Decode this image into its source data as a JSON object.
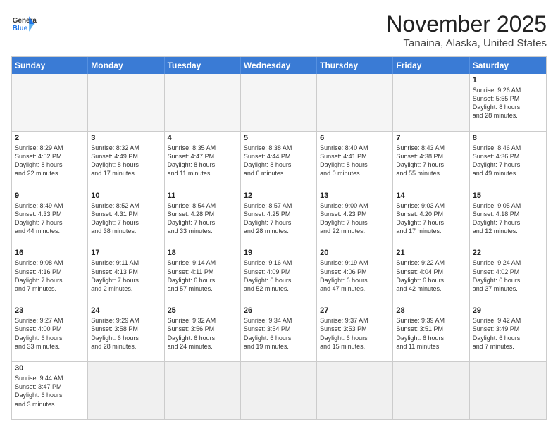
{
  "logo": {
    "text_general": "General",
    "text_blue": "Blue"
  },
  "title": "November 2025",
  "location": "Tanaina, Alaska, United States",
  "weekdays": [
    "Sunday",
    "Monday",
    "Tuesday",
    "Wednesday",
    "Thursday",
    "Friday",
    "Saturday"
  ],
  "weeks": [
    [
      {
        "day": "",
        "content": ""
      },
      {
        "day": "",
        "content": ""
      },
      {
        "day": "",
        "content": ""
      },
      {
        "day": "",
        "content": ""
      },
      {
        "day": "",
        "content": ""
      },
      {
        "day": "",
        "content": ""
      },
      {
        "day": "1",
        "content": "Sunrise: 9:26 AM\nSunset: 5:55 PM\nDaylight: 8 hours\nand 28 minutes."
      }
    ],
    [
      {
        "day": "2",
        "content": "Sunrise: 8:29 AM\nSunset: 4:52 PM\nDaylight: 8 hours\nand 22 minutes."
      },
      {
        "day": "3",
        "content": "Sunrise: 8:32 AM\nSunset: 4:49 PM\nDaylight: 8 hours\nand 17 minutes."
      },
      {
        "day": "4",
        "content": "Sunrise: 8:35 AM\nSunset: 4:47 PM\nDaylight: 8 hours\nand 11 minutes."
      },
      {
        "day": "5",
        "content": "Sunrise: 8:38 AM\nSunset: 4:44 PM\nDaylight: 8 hours\nand 6 minutes."
      },
      {
        "day": "6",
        "content": "Sunrise: 8:40 AM\nSunset: 4:41 PM\nDaylight: 8 hours\nand 0 minutes."
      },
      {
        "day": "7",
        "content": "Sunrise: 8:43 AM\nSunset: 4:38 PM\nDaylight: 7 hours\nand 55 minutes."
      },
      {
        "day": "8",
        "content": "Sunrise: 8:46 AM\nSunset: 4:36 PM\nDaylight: 7 hours\nand 49 minutes."
      }
    ],
    [
      {
        "day": "9",
        "content": "Sunrise: 8:49 AM\nSunset: 4:33 PM\nDaylight: 7 hours\nand 44 minutes."
      },
      {
        "day": "10",
        "content": "Sunrise: 8:52 AM\nSunset: 4:31 PM\nDaylight: 7 hours\nand 38 minutes."
      },
      {
        "day": "11",
        "content": "Sunrise: 8:54 AM\nSunset: 4:28 PM\nDaylight: 7 hours\nand 33 minutes."
      },
      {
        "day": "12",
        "content": "Sunrise: 8:57 AM\nSunset: 4:25 PM\nDaylight: 7 hours\nand 28 minutes."
      },
      {
        "day": "13",
        "content": "Sunrise: 9:00 AM\nSunset: 4:23 PM\nDaylight: 7 hours\nand 22 minutes."
      },
      {
        "day": "14",
        "content": "Sunrise: 9:03 AM\nSunset: 4:20 PM\nDaylight: 7 hours\nand 17 minutes."
      },
      {
        "day": "15",
        "content": "Sunrise: 9:05 AM\nSunset: 4:18 PM\nDaylight: 7 hours\nand 12 minutes."
      }
    ],
    [
      {
        "day": "16",
        "content": "Sunrise: 9:08 AM\nSunset: 4:16 PM\nDaylight: 7 hours\nand 7 minutes."
      },
      {
        "day": "17",
        "content": "Sunrise: 9:11 AM\nSunset: 4:13 PM\nDaylight: 7 hours\nand 2 minutes."
      },
      {
        "day": "18",
        "content": "Sunrise: 9:14 AM\nSunset: 4:11 PM\nDaylight: 6 hours\nand 57 minutes."
      },
      {
        "day": "19",
        "content": "Sunrise: 9:16 AM\nSunset: 4:09 PM\nDaylight: 6 hours\nand 52 minutes."
      },
      {
        "day": "20",
        "content": "Sunrise: 9:19 AM\nSunset: 4:06 PM\nDaylight: 6 hours\nand 47 minutes."
      },
      {
        "day": "21",
        "content": "Sunrise: 9:22 AM\nSunset: 4:04 PM\nDaylight: 6 hours\nand 42 minutes."
      },
      {
        "day": "22",
        "content": "Sunrise: 9:24 AM\nSunset: 4:02 PM\nDaylight: 6 hours\nand 37 minutes."
      }
    ],
    [
      {
        "day": "23",
        "content": "Sunrise: 9:27 AM\nSunset: 4:00 PM\nDaylight: 6 hours\nand 33 minutes."
      },
      {
        "day": "24",
        "content": "Sunrise: 9:29 AM\nSunset: 3:58 PM\nDaylight: 6 hours\nand 28 minutes."
      },
      {
        "day": "25",
        "content": "Sunrise: 9:32 AM\nSunset: 3:56 PM\nDaylight: 6 hours\nand 24 minutes."
      },
      {
        "day": "26",
        "content": "Sunrise: 9:34 AM\nSunset: 3:54 PM\nDaylight: 6 hours\nand 19 minutes."
      },
      {
        "day": "27",
        "content": "Sunrise: 9:37 AM\nSunset: 3:53 PM\nDaylight: 6 hours\nand 15 minutes."
      },
      {
        "day": "28",
        "content": "Sunrise: 9:39 AM\nSunset: 3:51 PM\nDaylight: 6 hours\nand 11 minutes."
      },
      {
        "day": "29",
        "content": "Sunrise: 9:42 AM\nSunset: 3:49 PM\nDaylight: 6 hours\nand 7 minutes."
      }
    ],
    [
      {
        "day": "30",
        "content": "Sunrise: 9:44 AM\nSunset: 3:47 PM\nDaylight: 6 hours\nand 3 minutes."
      },
      {
        "day": "",
        "content": ""
      },
      {
        "day": "",
        "content": ""
      },
      {
        "day": "",
        "content": ""
      },
      {
        "day": "",
        "content": ""
      },
      {
        "day": "",
        "content": ""
      },
      {
        "day": "",
        "content": ""
      }
    ]
  ]
}
